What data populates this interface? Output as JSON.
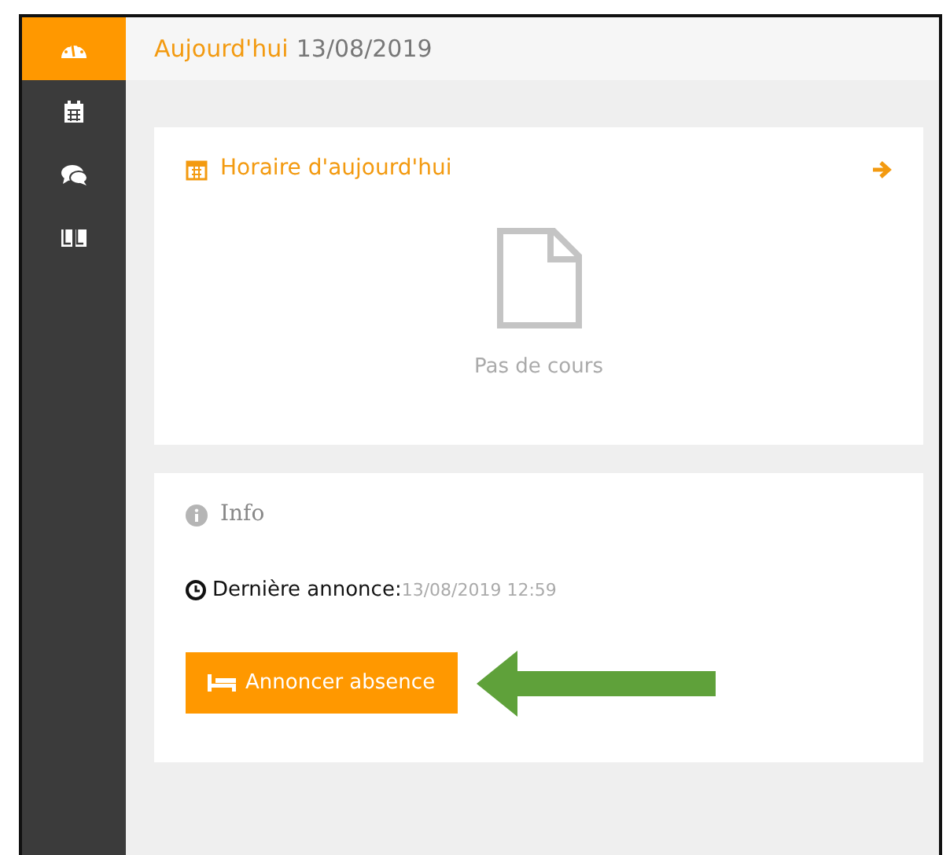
{
  "sidebar": {
    "items": [
      {
        "kind": "dashboard",
        "selected": true
      },
      {
        "kind": "calendar",
        "selected": false
      },
      {
        "kind": "chat",
        "selected": false
      },
      {
        "kind": "book",
        "selected": false
      }
    ]
  },
  "header": {
    "title": "Aujourd'hui",
    "date": "13/08/2019"
  },
  "schedule_card": {
    "title": "Horaire d'aujourd'hui",
    "empty_text": "Pas de cours"
  },
  "info_card": {
    "title": "Info",
    "last_label": "Dernière annonce:",
    "last_value": "13/08/2019 12:59",
    "button": "Annoncer absence"
  }
}
